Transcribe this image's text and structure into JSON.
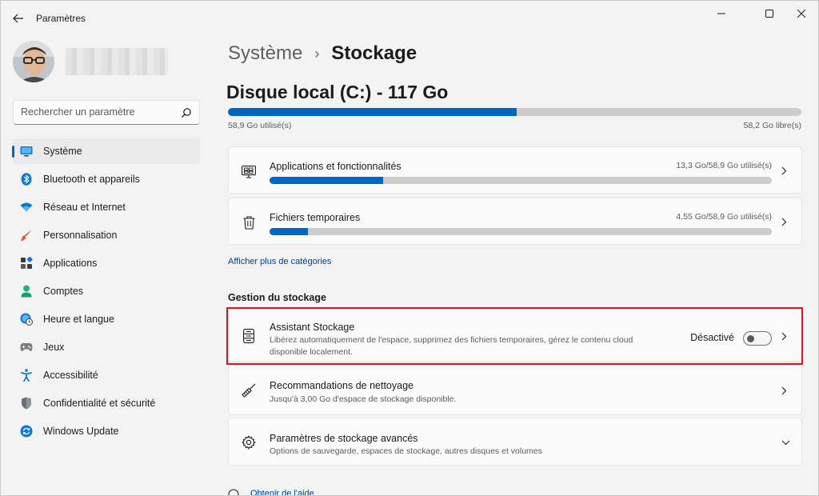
{
  "window": {
    "title": "Paramètres",
    "controls": {
      "minimize": "minimize",
      "maximize": "maximize",
      "close": "close"
    }
  },
  "sidebar": {
    "search_placeholder": "Rechercher un paramètre",
    "items": [
      {
        "label": "Système",
        "icon": "system-icon",
        "active": true
      },
      {
        "label": "Bluetooth et appareils",
        "icon": "bluetooth-icon"
      },
      {
        "label": "Réseau et Internet",
        "icon": "wifi-icon"
      },
      {
        "label": "Personnalisation",
        "icon": "brush-icon"
      },
      {
        "label": "Applications",
        "icon": "apps-icon"
      },
      {
        "label": "Comptes",
        "icon": "person-icon"
      },
      {
        "label": "Heure et langue",
        "icon": "globe-clock-icon"
      },
      {
        "label": "Jeux",
        "icon": "gamepad-icon"
      },
      {
        "label": "Accessibilité",
        "icon": "accessibility-icon"
      },
      {
        "label": "Confidentialité et sécurité",
        "icon": "shield-icon"
      },
      {
        "label": "Windows Update",
        "icon": "update-icon"
      }
    ]
  },
  "breadcrumb": {
    "parent": "Système",
    "separator": "›",
    "current": "Stockage"
  },
  "disk": {
    "title": "Disque local (C:) - 117 Go",
    "used_fraction": 0.503,
    "used_label": "58,9 Go utilisé(s)",
    "free_label": "58,2 Go libre(s)"
  },
  "categories": [
    {
      "title": "Applications et fonctionnalités",
      "size": "13,3 Go/58,9 Go utilisé(s)",
      "fraction": 0.226,
      "icon": "apps-monitor-icon"
    },
    {
      "title": "Fichiers temporaires",
      "size": "4,55 Go/58,9 Go utilisé(s)",
      "fraction": 0.077,
      "icon": "trash-icon"
    }
  ],
  "more_categories_link": "Afficher plus de catégories",
  "management": {
    "section_title": "Gestion du stockage",
    "storage_sense": {
      "title": "Assistant Stockage",
      "description": "Libérez automatiquement de l'espace, supprimez des fichiers temporaires, gérez le contenu cloud disponible localement.",
      "toggle_label": "Désactivé",
      "toggle_on": false
    },
    "cleanup": {
      "title": "Recommandations de nettoyage",
      "description": "Jusqu'à 3,00 Go d'espace de stockage disponible."
    },
    "advanced": {
      "title": "Paramètres de stockage avancés",
      "description": "Options de sauvegarde, espaces de stockage, autres disques et volumes"
    }
  },
  "help_link": "Obtenir de l'aide",
  "colors": {
    "accent": "#0067c0",
    "highlight": "#e0121b",
    "bar_bg": "#cdcdcd"
  }
}
